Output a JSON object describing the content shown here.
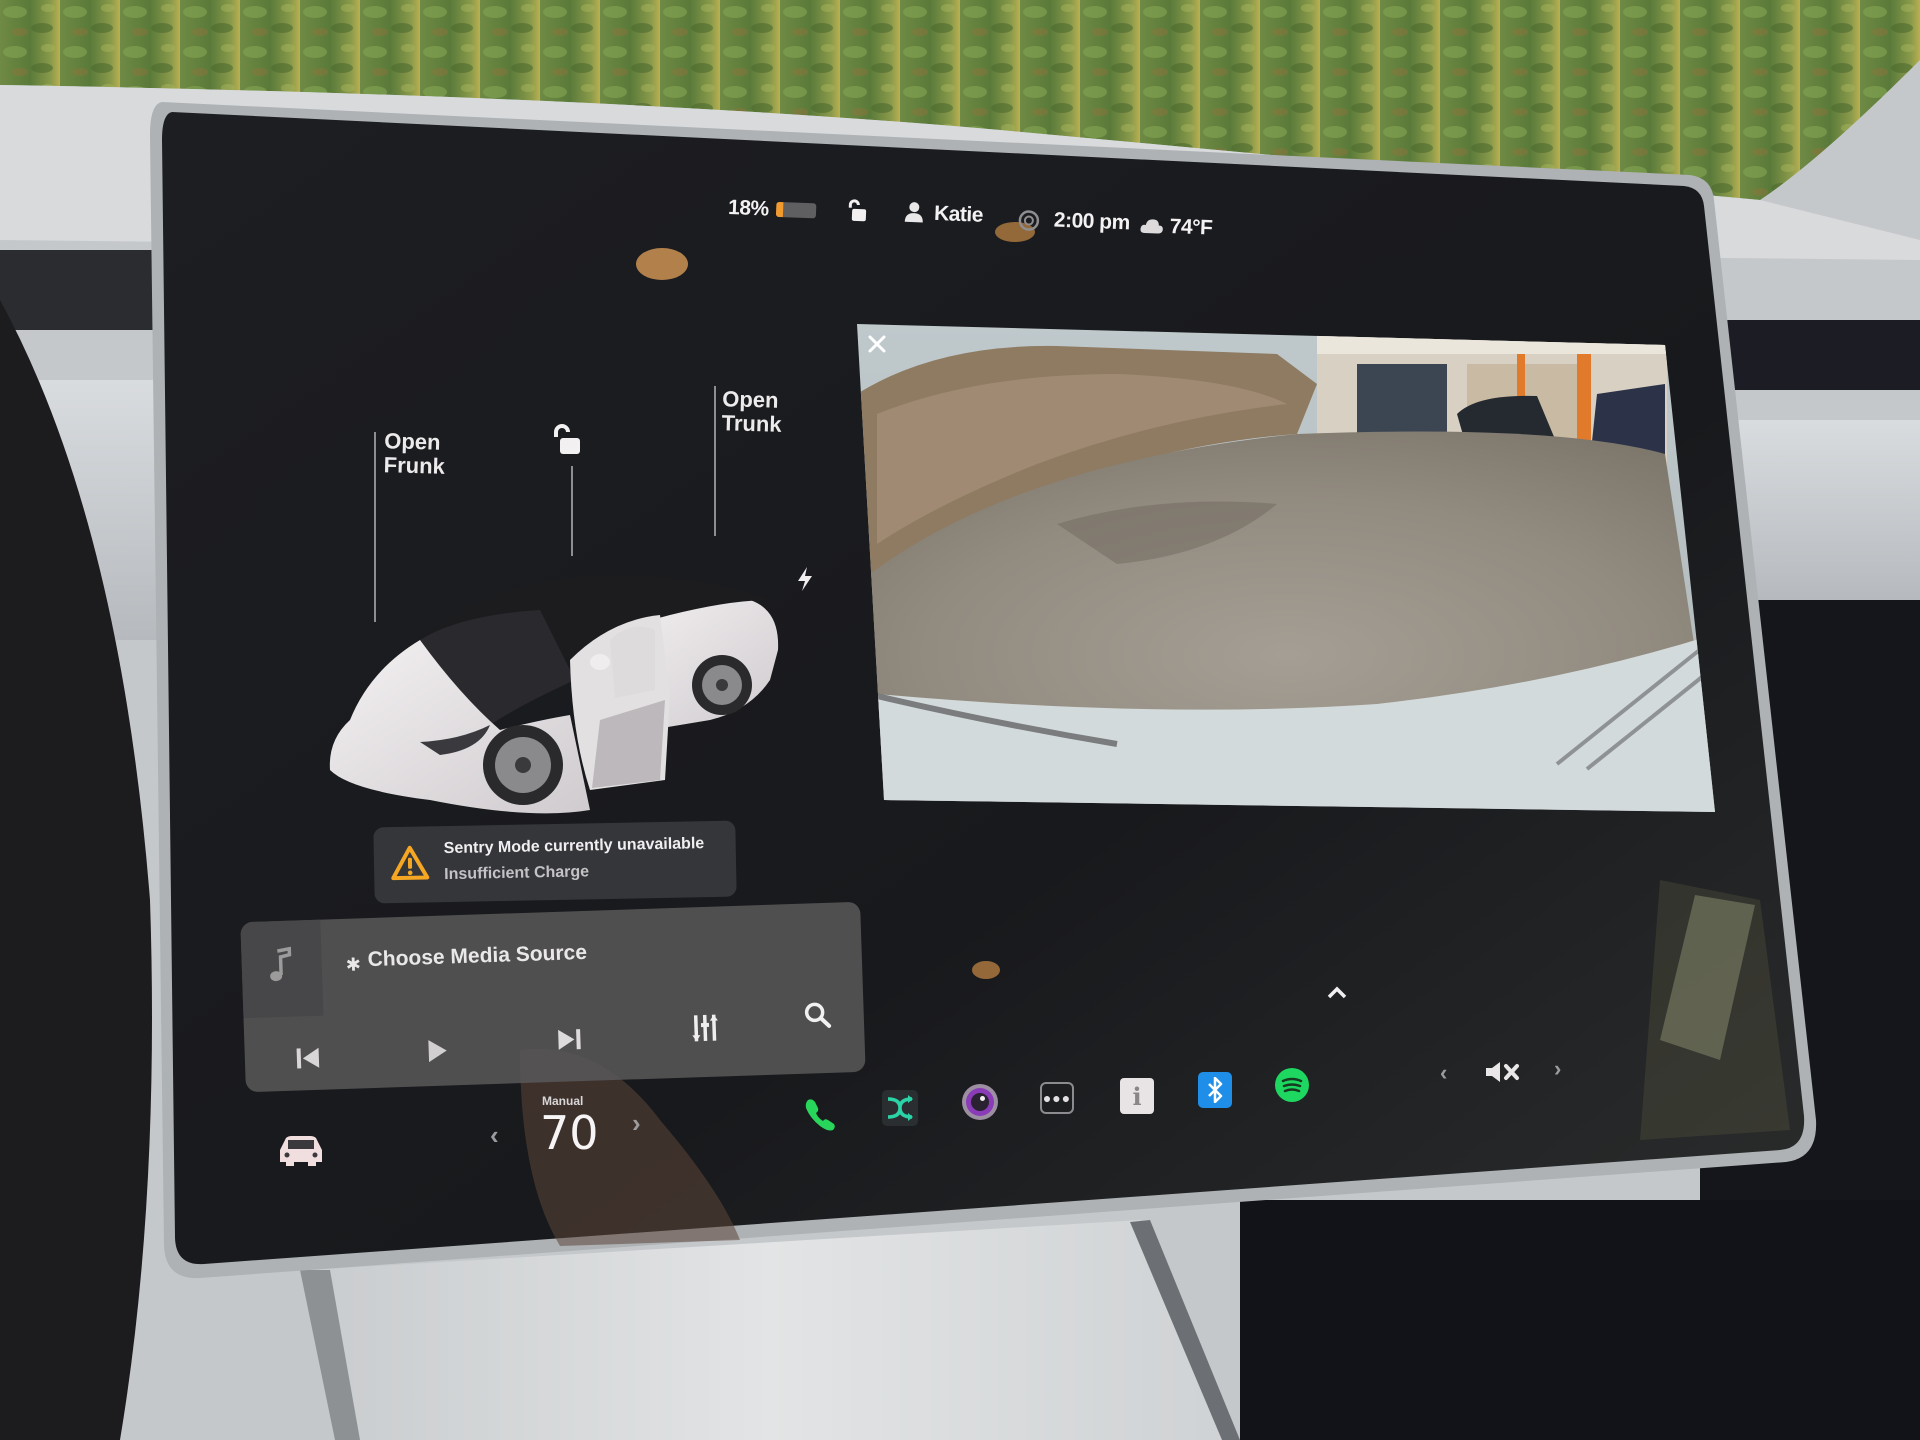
{
  "status_bar": {
    "battery_percent_label": "18%",
    "battery_level_fraction": 0.18,
    "battery_color": "#f29a2e",
    "lock_icon": "unlocked-padlock-icon",
    "profile_icon": "person-icon",
    "driver_name": "Katie",
    "sentry_icon": "sentry-camera-icon",
    "time": "2:00 pm",
    "weather_icon": "cloud-icon",
    "temperature": "74°F"
  },
  "car_panel": {
    "frunk_label_line1": "Open",
    "frunk_label_line2": "Frunk",
    "trunk_label_line1": "Open",
    "trunk_label_line2": "Trunk",
    "door_lock_icon": "unlocked-padlock-icon",
    "charge_port_icon": "lightning-bolt-icon"
  },
  "sentry_alert": {
    "icon": "warning-triangle-icon",
    "icon_color": "#f5a623",
    "title": "Sentry Mode currently unavailable",
    "subtitle": "Insufficient Charge"
  },
  "media_player": {
    "art_icon": "music-note-icon",
    "source_icon": "bluetooth-icon",
    "source_label": "Choose Media Source",
    "controls": [
      "previous-track",
      "play",
      "next-track",
      "equalizer",
      "search"
    ]
  },
  "camera_view": {
    "close_icon": "close-icon",
    "description": "Rear backup camera feed"
  },
  "bottom_bar": {
    "car_icon": "car-icon",
    "climate_mode_label": "Manual",
    "temperature_setting": "70",
    "dock_apps": [
      {
        "name": "phone",
        "color": "#27d65a"
      },
      {
        "name": "toybox",
        "color": "#27d7a8"
      },
      {
        "name": "camera",
        "color": "#8a3bb8"
      },
      {
        "name": "more",
        "color": "#cfcfd1"
      },
      {
        "name": "manual",
        "color": "#e8e4e6"
      },
      {
        "name": "bluetooth",
        "color": "#1e8ee8"
      },
      {
        "name": "spotify",
        "color": "#1ed760"
      }
    ],
    "expand_icon": "chevron-up-icon",
    "volume_icon": "volume-muted-icon"
  }
}
